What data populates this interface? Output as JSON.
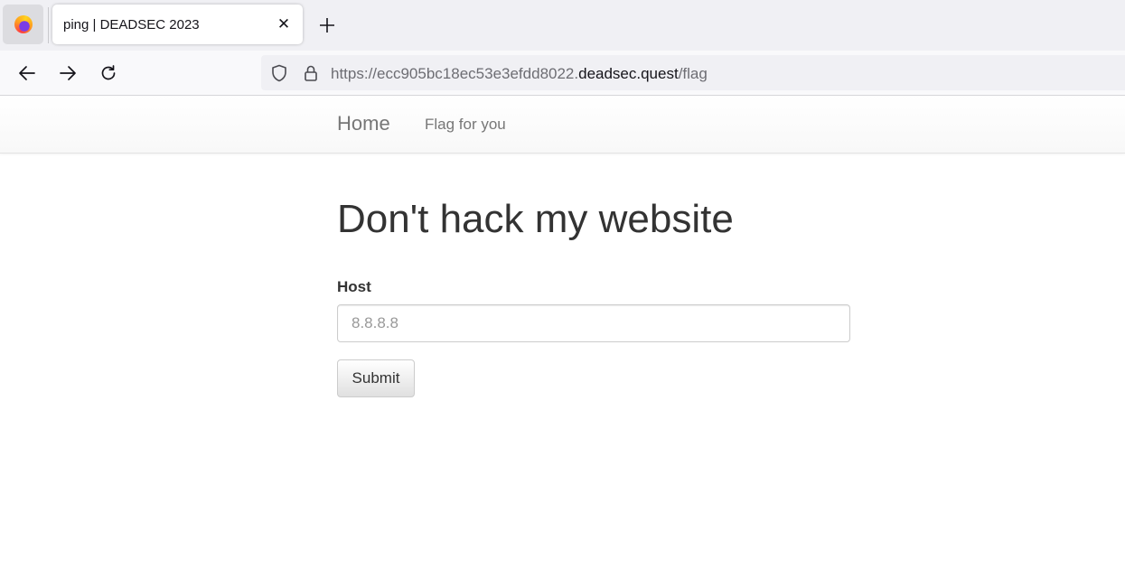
{
  "browser": {
    "tab_title": "ping | DEADSEC 2023",
    "tab_close_icon": "close-icon",
    "new_tab_icon": "plus-icon",
    "nav_icons": [
      "back-arrow-icon",
      "forward-arrow-icon",
      "reload-icon"
    ],
    "url": {
      "prefix": "https://ecc905bc18ec53e3efdd8022.",
      "domain": "deadsec.quest",
      "path": "/flag"
    }
  },
  "site_nav": {
    "brand": "Home",
    "links": [
      "Flag for you"
    ]
  },
  "main": {
    "title": "Don't hack my website",
    "host_label": "Host",
    "host_placeholder": "8.8.8.8",
    "host_value": "",
    "submit_label": "Submit"
  }
}
